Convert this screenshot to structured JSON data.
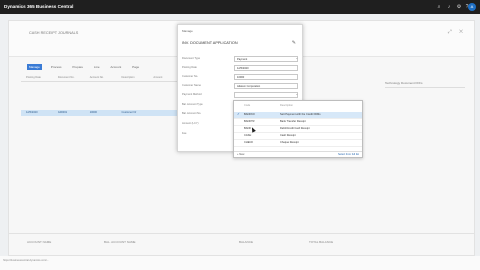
{
  "app": {
    "title": "Dynamics 365 Business Central",
    "avatar": "A"
  },
  "page": {
    "title": "CASH RECEIPT JOURNALS",
    "subtitle": "",
    "action_tabs": [
      "Manage",
      "Process",
      "Prepare",
      "Line",
      "Account",
      "Page"
    ],
    "active_tab": 0,
    "grid_headers": [
      "Posting Date",
      "Document No.",
      "Account No.",
      "Description",
      "Amount"
    ],
    "grid_row": [
      "1/25/2020",
      "G00001",
      "10000",
      "Customer Nr"
    ],
    "right_panel_title": "Technology Document FFFs",
    "totals": [
      {
        "label": "ACCOUNT NAME",
        "value": ""
      },
      {
        "label": "BAL. ACCOUNT NAME",
        "value": ""
      },
      {
        "label": "BALANCE",
        "value": ""
      },
      {
        "label": "TOTAL BALANCE",
        "value": ""
      }
    ]
  },
  "modal": {
    "caption": "Manage",
    "heading": "INV. DOCUMENT APPLICATION",
    "fields": [
      {
        "label": "Document Type",
        "value": "Payment",
        "kind": "select"
      },
      {
        "label": "Posting Date",
        "value": "1/25/2020",
        "kind": "input"
      },
      {
        "label": "Customer No.",
        "value": "10000",
        "kind": "input"
      },
      {
        "label": "Customer Name",
        "value": "Adatum Corporation",
        "kind": "input"
      },
      {
        "label": "Payment Method",
        "value": "",
        "kind": "select"
      },
      {
        "label": "Bal. Account Type",
        "value": "",
        "kind": "plain"
      },
      {
        "label": "Bal. Account No.",
        "value": "",
        "kind": "plain"
      },
      {
        "label": "Amount (LCY)",
        "value": "",
        "kind": "plain"
      },
      {
        "label": "Fee",
        "value": "",
        "kind": "plain"
      }
    ]
  },
  "dropdown": {
    "col_code": "Code",
    "col_desc": "Description",
    "rows": [
      {
        "code": "BANKKO",
        "desc": "Sett Payment with the Credit FDMs",
        "selected": true
      },
      {
        "code": "BANKTR",
        "desc": "Bank Transfer Receipt",
        "selected": false
      },
      {
        "code": "BANK",
        "desc": "Debit/Credit Card Receipt",
        "selected": false
      },
      {
        "code": "CASH",
        "desc": "Cash Receipt",
        "selected": false
      },
      {
        "code": "CHECK",
        "desc": "Cheque Receipt",
        "selected": false
      }
    ],
    "new_label": "+ New",
    "select_all_label": "Select from full list"
  },
  "status": {
    "url": "https://businesscentral.dynamics.com/..."
  },
  "colors": {
    "accent": "#3a7bd5",
    "topbar": "#1f1f1f",
    "selection": "#d7e8f8"
  },
  "icons": [
    "search-icon",
    "bell-icon",
    "gear-icon",
    "help-icon",
    "edit-icon",
    "chevron-down-icon",
    "check-icon"
  ]
}
